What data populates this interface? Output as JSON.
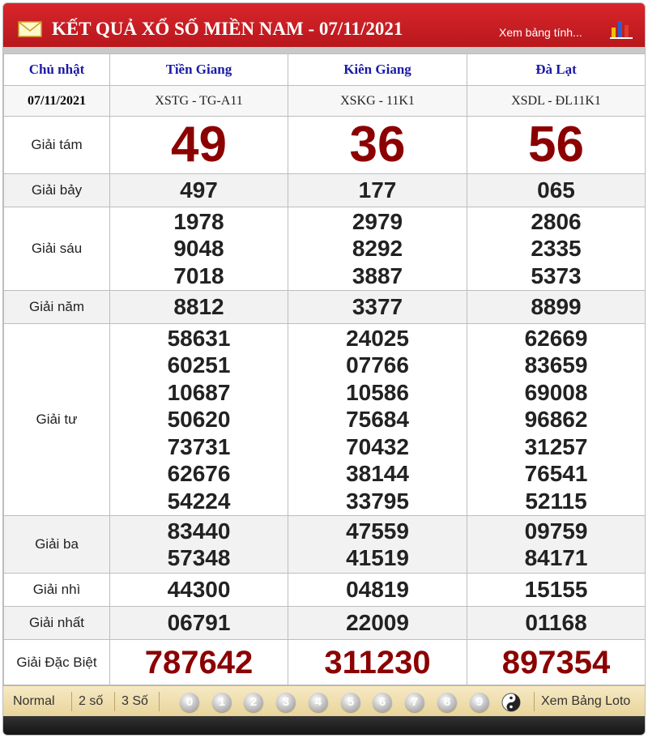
{
  "header": {
    "title": "KẾT QUẢ XỔ SỐ MIỀN NAM - 07/11/2021",
    "link": "Xem bảng tính..."
  },
  "table": {
    "day": "Chủ nhật",
    "date": "07/11/2021",
    "provinces": [
      "Tiền Giang",
      "Kiên Giang",
      "Đà Lạt"
    ],
    "codes": [
      "XSTG - TG-A11",
      "XSKG - 11K1",
      "XSDL - ĐL11K1"
    ],
    "prizes": [
      {
        "label": "Giải tám",
        "results": [
          [
            "49"
          ],
          [
            "36"
          ],
          [
            "56"
          ]
        ]
      },
      {
        "label": "Giải bảy",
        "results": [
          [
            "497"
          ],
          [
            "177"
          ],
          [
            "065"
          ]
        ]
      },
      {
        "label": "Giải sáu",
        "results": [
          [
            "1978",
            "9048",
            "7018"
          ],
          [
            "2979",
            "8292",
            "3887"
          ],
          [
            "2806",
            "2335",
            "5373"
          ]
        ]
      },
      {
        "label": "Giải năm",
        "results": [
          [
            "8812"
          ],
          [
            "3377"
          ],
          [
            "8899"
          ]
        ]
      },
      {
        "label": "Giải tư",
        "results": [
          [
            "58631",
            "60251",
            "10687",
            "50620",
            "73731",
            "62676",
            "54224"
          ],
          [
            "24025",
            "07766",
            "10586",
            "75684",
            "70432",
            "38144",
            "33795"
          ],
          [
            "62669",
            "83659",
            "69008",
            "96862",
            "31257",
            "76541",
            "52115"
          ]
        ]
      },
      {
        "label": "Giải ba",
        "results": [
          [
            "83440",
            "57348"
          ],
          [
            "47559",
            "41519"
          ],
          [
            "09759",
            "84171"
          ]
        ]
      },
      {
        "label": "Giải nhì",
        "results": [
          [
            "44300"
          ],
          [
            "04819"
          ],
          [
            "15155"
          ]
        ]
      },
      {
        "label": "Giải nhất",
        "results": [
          [
            "06791"
          ],
          [
            "22009"
          ],
          [
            "01168"
          ]
        ]
      },
      {
        "label": "Giải Đặc Biệt",
        "results": [
          [
            "787642"
          ],
          [
            "311230"
          ],
          [
            "897354"
          ]
        ]
      }
    ]
  },
  "footer": {
    "modes": [
      "Normal",
      "2 số",
      "3 Số"
    ],
    "digits": [
      "0",
      "1",
      "2",
      "3",
      "4",
      "5",
      "6",
      "7",
      "8",
      "9"
    ],
    "loto_link": "Xem Bảng Loto"
  },
  "colors": {
    "header_red": "#c41e22",
    "prize_red": "#8b0000",
    "province_blue": "#1a1aa6"
  }
}
